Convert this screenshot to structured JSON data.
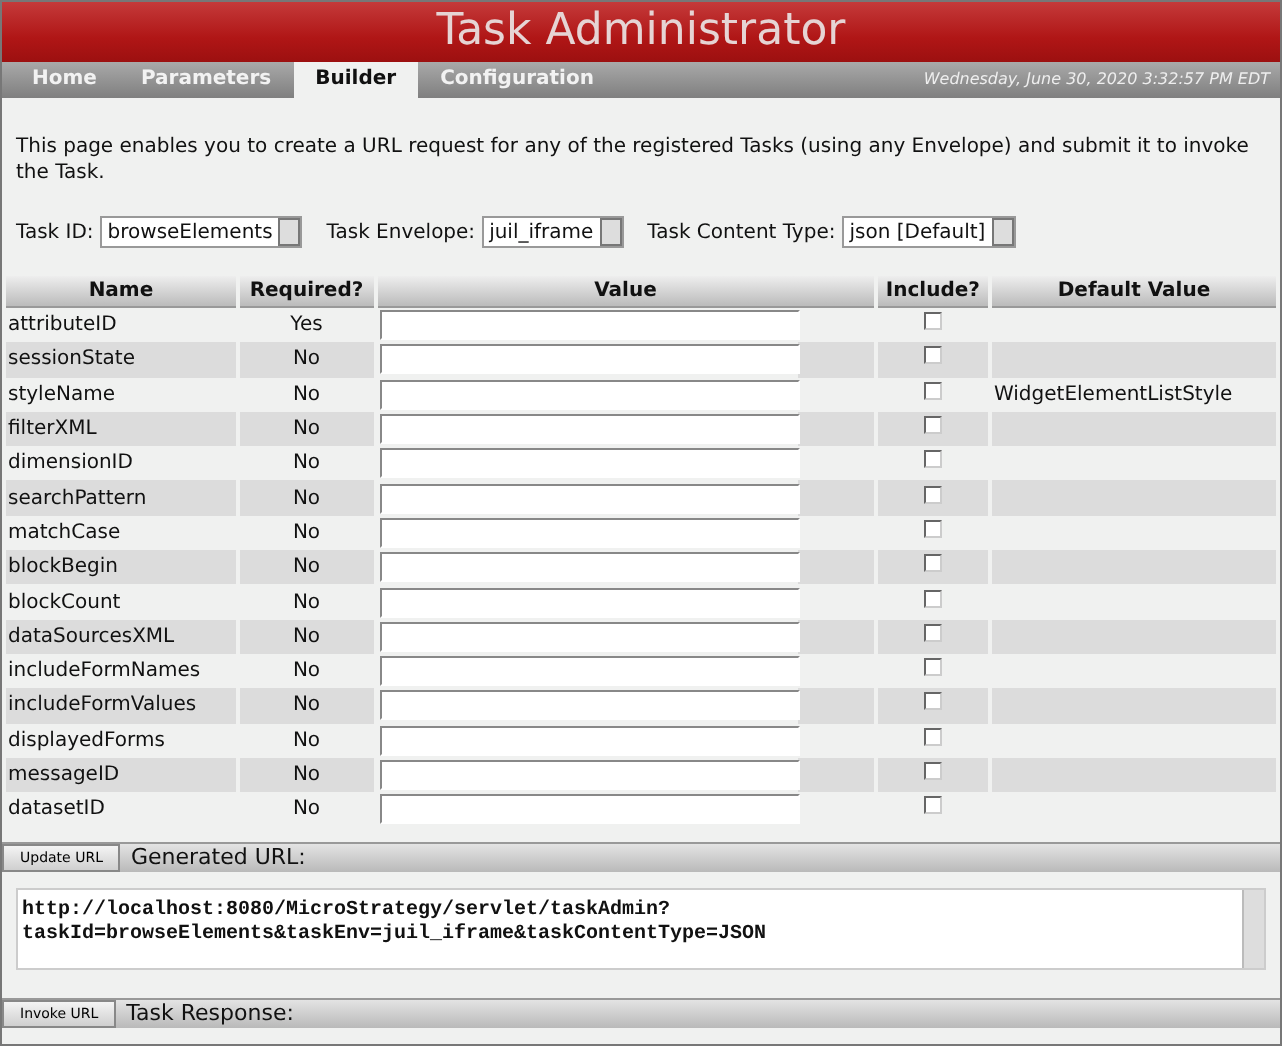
{
  "window": {
    "title": "Task Administrator"
  },
  "tabs": [
    {
      "label": "Home",
      "selected": false
    },
    {
      "label": "Parameters",
      "selected": false
    },
    {
      "label": "Builder",
      "selected": true
    },
    {
      "label": "Configuration",
      "selected": false
    }
  ],
  "timestamp": "Wednesday, June 30, 2020 3:32:57 PM EDT",
  "description": "This page enables you to create a URL request for any of the registered Tasks (using any Envelope) and submit it to invoke the Task.",
  "selectors": [
    {
      "label": "Task ID:",
      "value": "browseElements"
    },
    {
      "label": "Task Envelope:",
      "value": "juil_iframe"
    },
    {
      "label": "Task Content Type:",
      "value": "json [Default]"
    }
  ],
  "table": {
    "columns": [
      "Name",
      "Required?",
      "Value",
      "Include?",
      "Default Value"
    ],
    "rows": [
      {
        "name": "attributeID",
        "required": "Yes",
        "included": false
      },
      {
        "name": "sessionState",
        "required": "No",
        "included": false
      },
      {
        "name": "styleName",
        "required": "No",
        "included": false,
        "default": "WidgetElementListStyle"
      },
      {
        "name": "filterXML",
        "required": "No",
        "included": false
      },
      {
        "name": "dimensionID",
        "required": "No",
        "included": false
      },
      {
        "name": "searchPattern",
        "required": "No",
        "included": false
      },
      {
        "name": "matchCase",
        "required": "No",
        "included": false
      },
      {
        "name": "blockBegin",
        "required": "No",
        "included": false
      },
      {
        "name": "blockCount",
        "required": "No",
        "included": false
      },
      {
        "name": "dataSourcesXML",
        "required": "No",
        "included": false
      },
      {
        "name": "includeFormNames",
        "required": "No",
        "included": false
      },
      {
        "name": "includeFormValues",
        "required": "No",
        "included": false
      },
      {
        "name": "displayedForms",
        "required": "No",
        "included": false
      },
      {
        "name": "messageID",
        "required": "No",
        "included": false
      },
      {
        "name": "datasetID",
        "required": "No",
        "included": false
      }
    ]
  },
  "update": {
    "button": "Update URL",
    "label": "Generated URL:",
    "url": "http://localhost:8080/MicroStrategy/servlet/taskAdmin?\ntaskId=browseElements&taskEnv=juil_iframe&taskContentType=JSON"
  },
  "invoke": {
    "button": "Invoke URL",
    "label": "Task Response:"
  }
}
